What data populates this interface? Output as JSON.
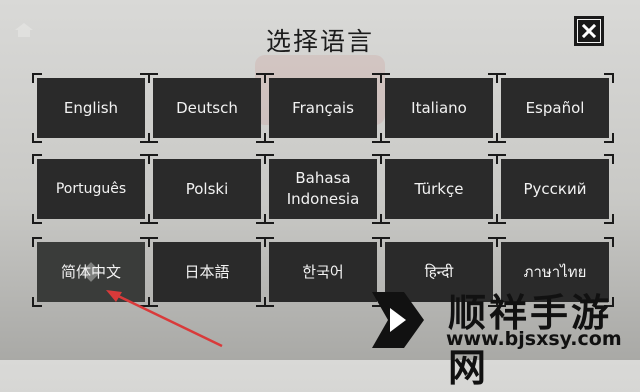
{
  "dialog": {
    "title": "选择语言"
  },
  "languages": [
    "English",
    "Deutsch",
    "Français",
    "Italiano",
    "Español",
    "Português",
    "Polski",
    "Bahasa Indonesia",
    "Türkçe",
    "Русский",
    "简体中文",
    "日本語",
    "한국어",
    "हिन्दी",
    "ภาษาไทย"
  ],
  "selected_language": "简体中文",
  "colors": {
    "tile": "#2a2a2a",
    "annotation_arrow": "#d93a3a"
  },
  "watermark": {
    "name": "顺祥手游网",
    "url": "www.bjsxsy.com"
  }
}
